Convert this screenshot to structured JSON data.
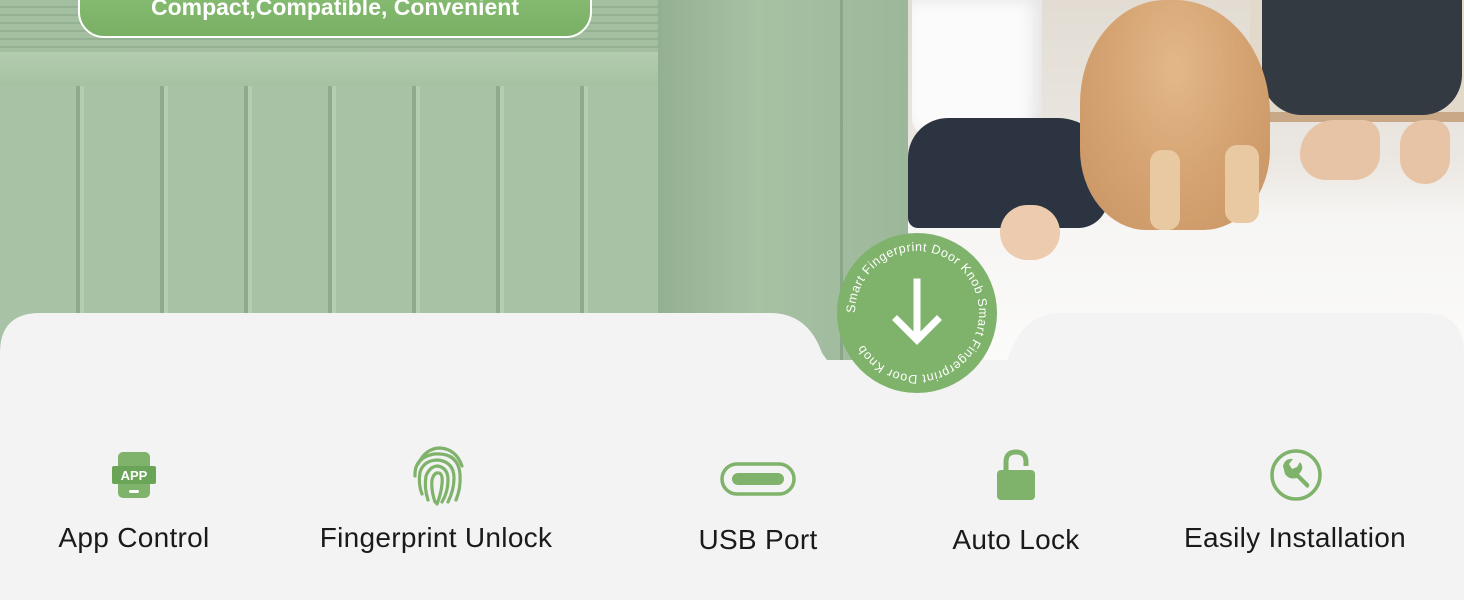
{
  "hero": {
    "tagline": "Compact,Compatible, Convenient"
  },
  "badge": {
    "ring_text": "Smart Fingerprint Door Knob Smart Fingerprint Door Knob",
    "icon": "arrow-down-icon",
    "color": "#7fb36b"
  },
  "features": [
    {
      "label": "App Control",
      "icon": "app-icon",
      "icon_text": "APP"
    },
    {
      "label": "Fingerprint Unlock",
      "icon": "fingerprint-icon"
    },
    {
      "label": "USB Port",
      "icon": "usb-c-icon"
    },
    {
      "label": "Auto Lock",
      "icon": "padlock-icon"
    },
    {
      "label": "Easily Installation",
      "icon": "wrench-icon"
    }
  ],
  "colors": {
    "accent": "#7fb36b",
    "panel": "#f3f3f3",
    "text": "#1a1a1a"
  }
}
